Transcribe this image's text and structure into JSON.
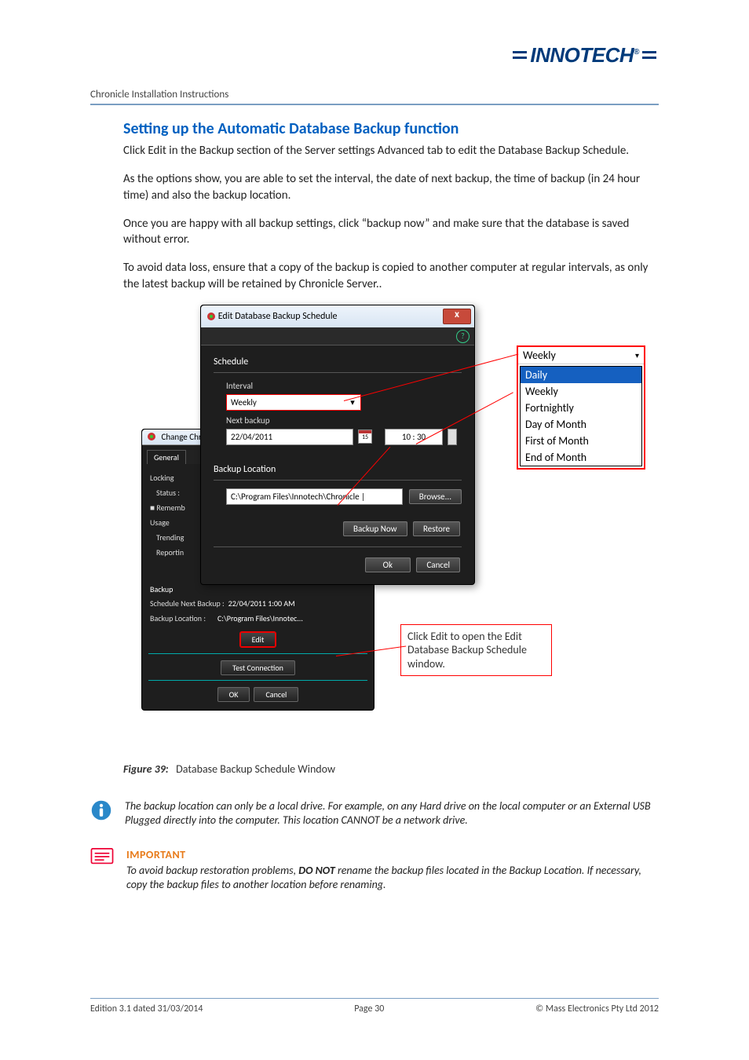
{
  "doc_header": "Chronicle Installation Instructions",
  "logo_text": "INNOTECH",
  "heading": "Setting up the Automatic Database Backup function",
  "para1": "Click Edit in the Backup section of the Server settings Advanced tab to edit the Database Backup Schedule.",
  "para2": "As the options show, you are able to set the interval, the date of next backup, the time of backup (in 24 hour time) and also the backup location.",
  "para3": "Once you are happy with all backup settings, click “backup now” and make sure that the database is saved without error.",
  "para4": "To avoid data loss, ensure that a copy of the backup is copied to another computer at regular intervals, as only the latest backup will be retained by Chronicle Server..",
  "dialog": {
    "title": "Edit Database Backup Schedule",
    "schedule_label": "Schedule",
    "interval_label": "Interval",
    "interval_value": "Weekly",
    "next_label": "Next backup",
    "date_value": "22/04/2011",
    "cal_day": "15",
    "time_value": "10 : 30",
    "loc_label": "Backup Location",
    "loc_value": "C:\\Program Files\\Innotech\\Chronicle |",
    "browse_btn": "Browse...",
    "backup_now_btn": "Backup Now",
    "restore_btn": "Restore",
    "ok_btn": "Ok",
    "cancel_btn": "Cancel"
  },
  "dropdown": {
    "selected": "Weekly",
    "options": [
      "Daily",
      "Weekly",
      "Fortnightly",
      "Day of Month",
      "First of Month",
      "End of Month"
    ]
  },
  "bgpanel": {
    "title": "Change Chronic",
    "tab1": "General",
    "side": {
      "locking": "Locking",
      "status": "Status :",
      "remember": "Rememb",
      "usage": "Usage",
      "trending": "Trending",
      "reporting": "Reportin"
    },
    "edit_btn": "Edit",
    "backup_label": "Backup",
    "sched_label": "Schedule Next Backup :",
    "sched_val": "22/04/2011 1:00 AM",
    "bloc_label": "Backup Location :",
    "bloc_val": "C:\\Program Files\\Innotec...",
    "edit_btn2": "Edit",
    "test_btn": "Test Connection",
    "ok_btn": "OK",
    "cancel_btn": "Cancel"
  },
  "callout_text": "Click Edit to open the Edit Database Backup Schedule window.",
  "caption_prefix": "Figure 39:",
  "caption_text": "Database Backup Schedule Window",
  "info_note": "The backup location can only be a local drive. For example, on any Hard drive on the local computer or an External USB Plugged directly into the computer. This location CANNOT be a network drive.",
  "important_label": "IMPORTANT",
  "important_text_a": "To avoid backup restoration problems, ",
  "important_text_b": "DO NOT",
  "important_text_c": " rename the backup files located in the Backup Location. If necessary, copy the backup files to another location before renaming.",
  "footer": {
    "left": "Edition 3.1 dated 31/03/2014",
    "center": "Page 30",
    "right": "©  Mass Electronics Pty Ltd  2012"
  }
}
